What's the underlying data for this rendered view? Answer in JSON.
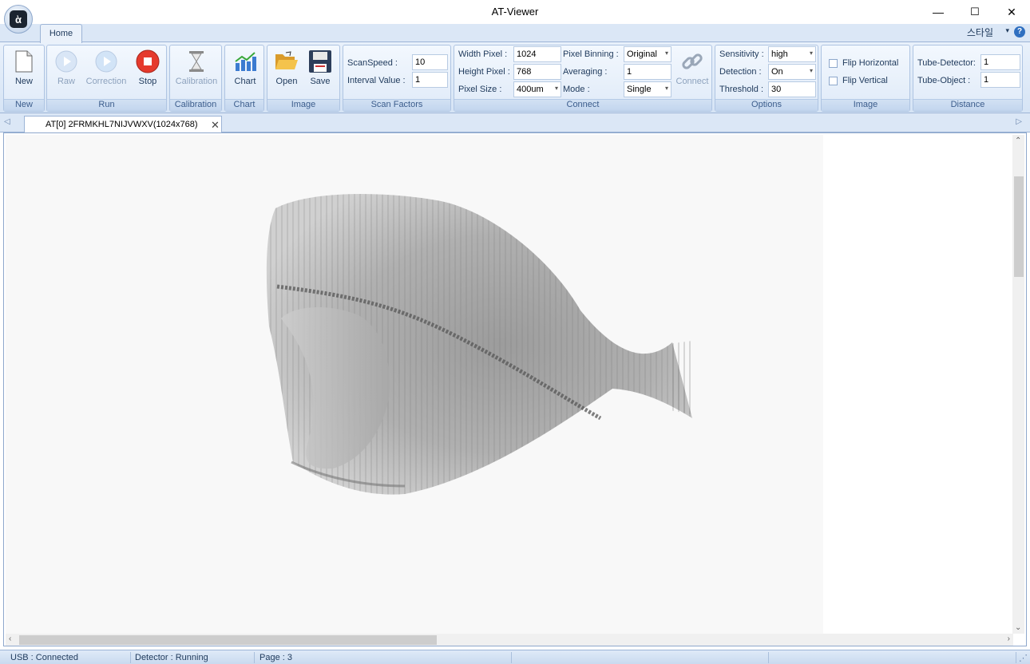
{
  "window": {
    "title": "AT-Viewer",
    "minimize": "—",
    "maximize": "☐",
    "close": "✕"
  },
  "ribbon": {
    "home_tab": "Home",
    "style_menu": "스타일",
    "groups": {
      "new": "New",
      "run": "Run",
      "calibration": "Calibration",
      "chart": "Chart",
      "image": "Image",
      "scan_factors": "Scan Factors",
      "connect": "Connect",
      "options": "Options",
      "image2": "Image",
      "distance": "Distance"
    },
    "buttons": {
      "new": "New",
      "raw": "Raw",
      "correction": "Correction",
      "stop": "Stop",
      "calibration": "Calibration",
      "chart": "Chart",
      "open": "Open",
      "save": "Save",
      "connect": "Connect"
    },
    "scan": {
      "scan_speed_label": "ScanSpeed  :",
      "scan_speed": "10",
      "interval_label": "Interval Value  :",
      "interval": "1"
    },
    "connect": {
      "width_label": "Width Pixel :",
      "width": "1024",
      "height_label": "Height Pixel :",
      "height": "768",
      "pixel_size_label": "Pixel Size     :",
      "pixel_size": "400um",
      "binning_label": "Pixel Binning :",
      "binning": "Original",
      "averaging_label": "Averaging    :",
      "averaging": "1",
      "mode_label": "Mode          :",
      "mode": "Single"
    },
    "options": {
      "sensitivity_label": "Sensitivity :",
      "sensitivity": "high",
      "detection_label": "Detection :",
      "detection": "On",
      "threshold_label": "Threshold :",
      "threshold": "30"
    },
    "image": {
      "flip_h": "Flip Horizontal",
      "flip_v": "Flip Vertical"
    },
    "distance": {
      "tube_detector_label": "Tube-Detector:",
      "tube_detector": "1",
      "tube_object_label": "Tube-Object :",
      "tube_object": "1"
    }
  },
  "document_tab": {
    "label": "AT[0]  2FRMKHL7NIJVWXV(1024x768)"
  },
  "status": {
    "usb": "USB : Connected",
    "detector": "Detector : Running",
    "page": "Page : 3"
  }
}
